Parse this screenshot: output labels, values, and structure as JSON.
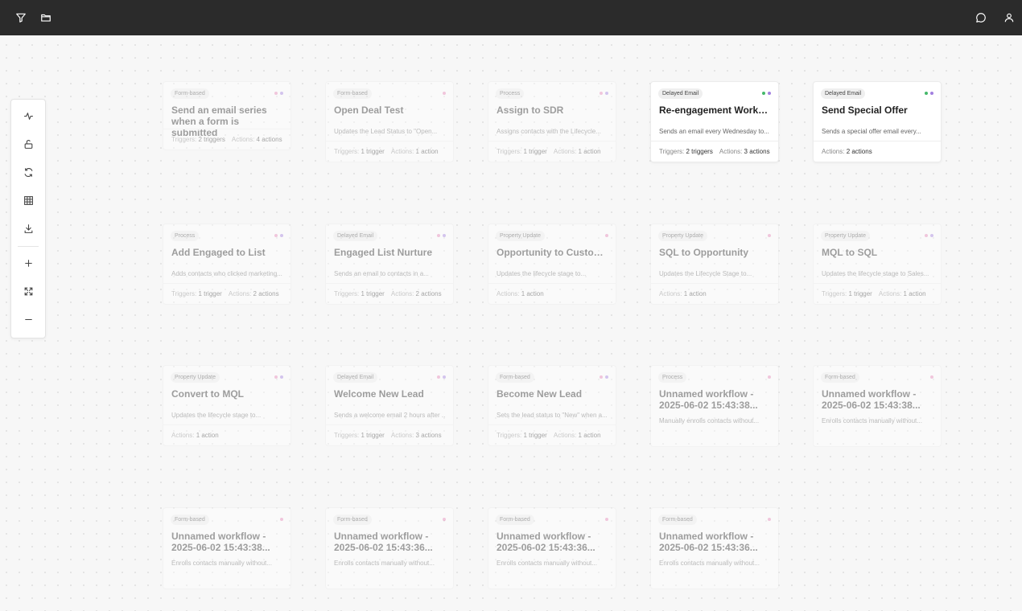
{
  "colors": {
    "pink": "#e884b8",
    "purple": "#a27fe0",
    "green": "#45b86a"
  },
  "topbar": {
    "left_icons": [
      "filter-icon",
      "folder-icon"
    ],
    "right_icons": [
      "chat-icon",
      "user-icon"
    ]
  },
  "toolbar": {
    "tools": [
      "activity-icon",
      "unlock-icon",
      "refresh-icon",
      "grid-icon",
      "download-icon",
      "plus-icon",
      "expand-icon",
      "minus-icon"
    ]
  },
  "cards": [
    {
      "type": "Form-based",
      "title": "Send an email series when a form is submitted",
      "description": "",
      "triggers": "2 triggers",
      "actions": "4 actions",
      "dots": [
        "pink",
        "purple"
      ]
    },
    {
      "type": "Form-based",
      "title": "Open Deal Test",
      "description": "Updates the Lead Status to \"Open...",
      "triggers": "1 trigger",
      "actions": "1 action",
      "dots": [
        "pink"
      ]
    },
    {
      "type": "Process",
      "title": "Assign to SDR",
      "description": "Assigns contacts with the Lifecycle...",
      "triggers": "1 trigger",
      "actions": "1 action",
      "dots": [
        "pink",
        "purple"
      ]
    },
    {
      "type": "Delayed Email",
      "title": "Re-engagement Workflow",
      "description": "Sends an email every Wednesday to...",
      "triggers": "2 triggers",
      "actions": "3 actions",
      "dots": [
        "green",
        "purple"
      ],
      "active": true
    },
    {
      "type": "Delayed Email",
      "title": "Send Special Offer",
      "description": "Sends a special offer email every...",
      "triggers": "",
      "actions": "2 actions",
      "dots": [
        "green",
        "purple"
      ],
      "active": true
    },
    {
      "type": "Process",
      "title": "Add Engaged to List",
      "description": "Adds contacts who clicked marketing...",
      "triggers": "1 trigger",
      "actions": "2 actions",
      "dots": [
        "pink",
        "purple"
      ]
    },
    {
      "type": "Delayed Email",
      "title": "Engaged List Nurture",
      "description": "Sends an email to contacts in a...",
      "triggers": "1 trigger",
      "actions": "2 actions",
      "dots": [
        "pink",
        "purple"
      ]
    },
    {
      "type": "Property Update",
      "title": "Opportunity to Customer",
      "description": "Updates the lifecycle stage to...",
      "triggers": "",
      "actions": "1 action",
      "dots": [
        "pink"
      ]
    },
    {
      "type": "Property Update",
      "title": "SQL to Opportunity",
      "description": "Updates the Lifecycle Stage to...",
      "triggers": "",
      "actions": "1 action",
      "dots": [
        "pink"
      ]
    },
    {
      "type": "Property Update",
      "title": "MQL to SQL",
      "description": "Updates the lifecycle stage to Sales...",
      "triggers": "1 trigger",
      "actions": "1 action",
      "dots": [
        "pink",
        "purple"
      ]
    },
    {
      "type": "Property Update",
      "title": "Convert to MQL",
      "description": "Updates the lifecycle stage to...",
      "triggers": "",
      "actions": "1 action",
      "dots": [
        "pink",
        "purple"
      ]
    },
    {
      "type": "Delayed Email",
      "title": "Welcome New Lead",
      "description": "Sends a welcome email 2 hours after ...",
      "triggers": "1 trigger",
      "actions": "3 actions",
      "dots": [
        "pink",
        "purple"
      ]
    },
    {
      "type": "Form-based",
      "title": "Become New Lead",
      "description": "Sets the lead status to \"New\" when a...",
      "triggers": "1 trigger",
      "actions": "1 action",
      "dots": [
        "pink",
        "purple"
      ]
    },
    {
      "type": "Process",
      "title": "Unnamed workflow - 2025-06-02 15:43:38...",
      "description": "Manually enrolls contacts without...",
      "triggers": "",
      "actions": "",
      "dots": [
        "pink"
      ]
    },
    {
      "type": "Form-based",
      "title": "Unnamed workflow - 2025-06-02 15:43:38...",
      "description": "Enrolls contacts manually without...",
      "triggers": "",
      "actions": "",
      "dots": [
        "pink"
      ]
    },
    {
      "type": "Form-based",
      "title": "Unnamed workflow - 2025-06-02 15:43:38...",
      "description": "Enrolls contacts manually without...",
      "triggers": "",
      "actions": "",
      "dots": [
        "pink"
      ]
    },
    {
      "type": "Form-based",
      "title": "Unnamed workflow - 2025-06-02 15:43:36...",
      "description": "Enrolls contacts manually without...",
      "triggers": "",
      "actions": "",
      "dots": [
        "pink"
      ]
    },
    {
      "type": "Form-based",
      "title": "Unnamed workflow - 2025-06-02 15:43:36...",
      "description": "Enrolls contacts manually without...",
      "triggers": "",
      "actions": "",
      "dots": [
        "pink"
      ]
    },
    {
      "type": "Form-based",
      "title": "Unnamed workflow - 2025-06-02 15:43:36...",
      "description": "Enrolls contacts manually without...",
      "triggers": "",
      "actions": "",
      "dots": [
        "pink"
      ]
    }
  ],
  "labels": {
    "triggers": "Triggers:",
    "actions": "Actions:"
  }
}
